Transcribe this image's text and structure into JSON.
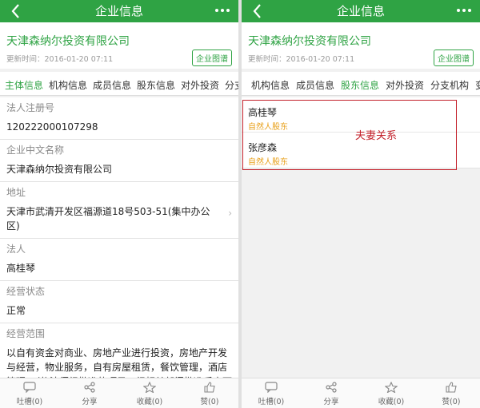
{
  "colors": {
    "accent": "#2fa344",
    "orange": "#e8a11c",
    "annotation_red": "#c3202a"
  },
  "left": {
    "nav": {
      "title": "企业信息"
    },
    "company": {
      "name": "天津森纳尔投资有限公司",
      "updated": "更新时间：2016-01-20 07:11",
      "graph_button": "企业图谱"
    },
    "tabs": [
      "主体信息",
      "机构信息",
      "成员信息",
      "股东信息",
      "对外投资",
      "分支"
    ],
    "active_tab": 0,
    "fields": [
      {
        "label": "法人注册号",
        "value": "120222000107298"
      },
      {
        "label": "企业中文名称",
        "value": "天津森纳尔投资有限公司"
      },
      {
        "label": "地址",
        "value": "天津市武清开发区福源道18号503-51(集中办公区)"
      },
      {
        "label": "法人",
        "value": "高桂琴"
      },
      {
        "label": "经营状态",
        "value": "正常"
      },
      {
        "label": "经营范围",
        "value": "以自有资金对商业、房地产业进行投资，房地产开发与经营，物业服务，自有房屋租赁，餐饮管理，酒店管理。（依法须经批准的项目，经相关部门批准后方可开展经营活动）"
      }
    ],
    "bottom": [
      "吐槽(0)",
      "分享",
      "收藏(0)",
      "赞(0)"
    ]
  },
  "right": {
    "nav": {
      "title": "企业信息"
    },
    "company": {
      "name": "天津森纳尔投资有限公司",
      "updated": "更新时间：2016-01-20 07:11",
      "graph_button": "企业图谱"
    },
    "tabs": [
      "机构信息",
      "成员信息",
      "股东信息",
      "对外投资",
      "分支机构",
      "变"
    ],
    "active_tab": 2,
    "shareholders": [
      {
        "name": "高桂琴",
        "type": "自然人股东"
      },
      {
        "name": "张彦森",
        "type": "自然人股东"
      }
    ],
    "annotation": "夫妻关系",
    "bottom": [
      "吐槽(0)",
      "分享",
      "收藏(0)",
      "赞(0)"
    ]
  },
  "icons": [
    "back-arrow-icon",
    "more-dots-icon",
    "comment-icon",
    "share-icon",
    "star-icon",
    "thumbs-up-icon",
    "chevron-right-icon"
  ]
}
